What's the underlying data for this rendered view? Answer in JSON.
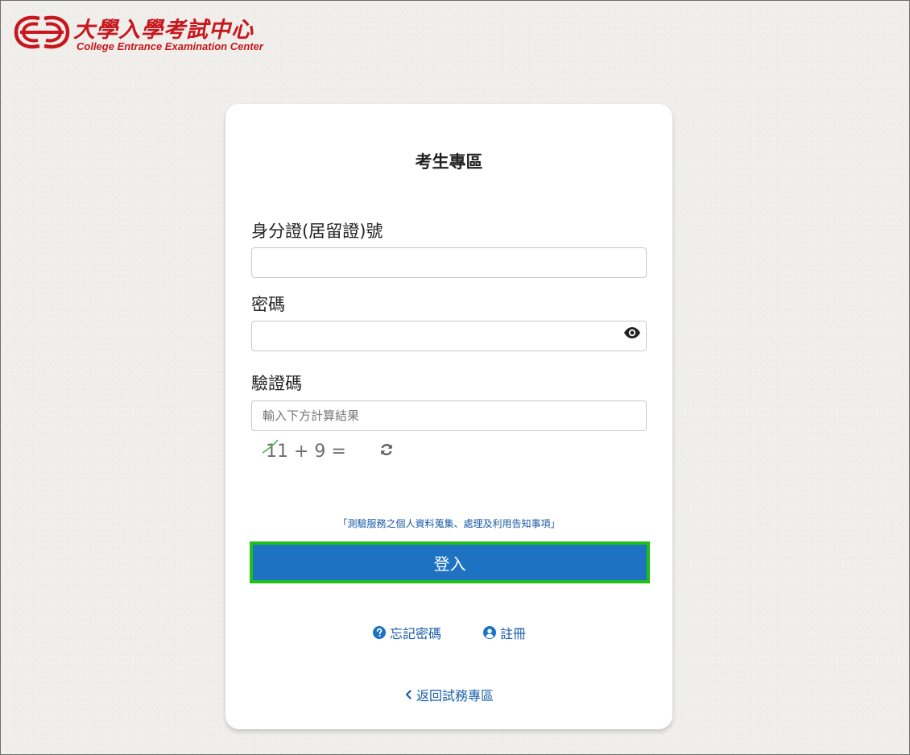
{
  "logo": {
    "chinese": "大學入學考試中心",
    "english": "College Entrance Examination Center"
  },
  "card": {
    "title": "考生專區",
    "id_label": "身分證(居留證)號",
    "id_value": "",
    "password_label": "密碼",
    "password_value": "",
    "captcha_label": "驗證碼",
    "captcha_placeholder": "輸入下方計算結果",
    "captcha_expression": "11 + 9 =",
    "privacy_notice": "「測驗服務之個人資料蒐集、處理及利用告知事項」",
    "login_button": "登入",
    "forgot_password": "忘記密碼",
    "register": "註冊",
    "back_link": "返回試務專區"
  },
  "colors": {
    "brand_red": "#c8161d",
    "primary_blue": "#1d72c2",
    "link_blue": "#1d5fa8",
    "highlight_green": "#1fc01a"
  },
  "icons": {
    "show_password": "eye-icon",
    "refresh_captcha": "refresh-icon",
    "forgot_password": "question-circle-icon",
    "register": "user-circle-icon",
    "back": "chevron-left-icon"
  }
}
